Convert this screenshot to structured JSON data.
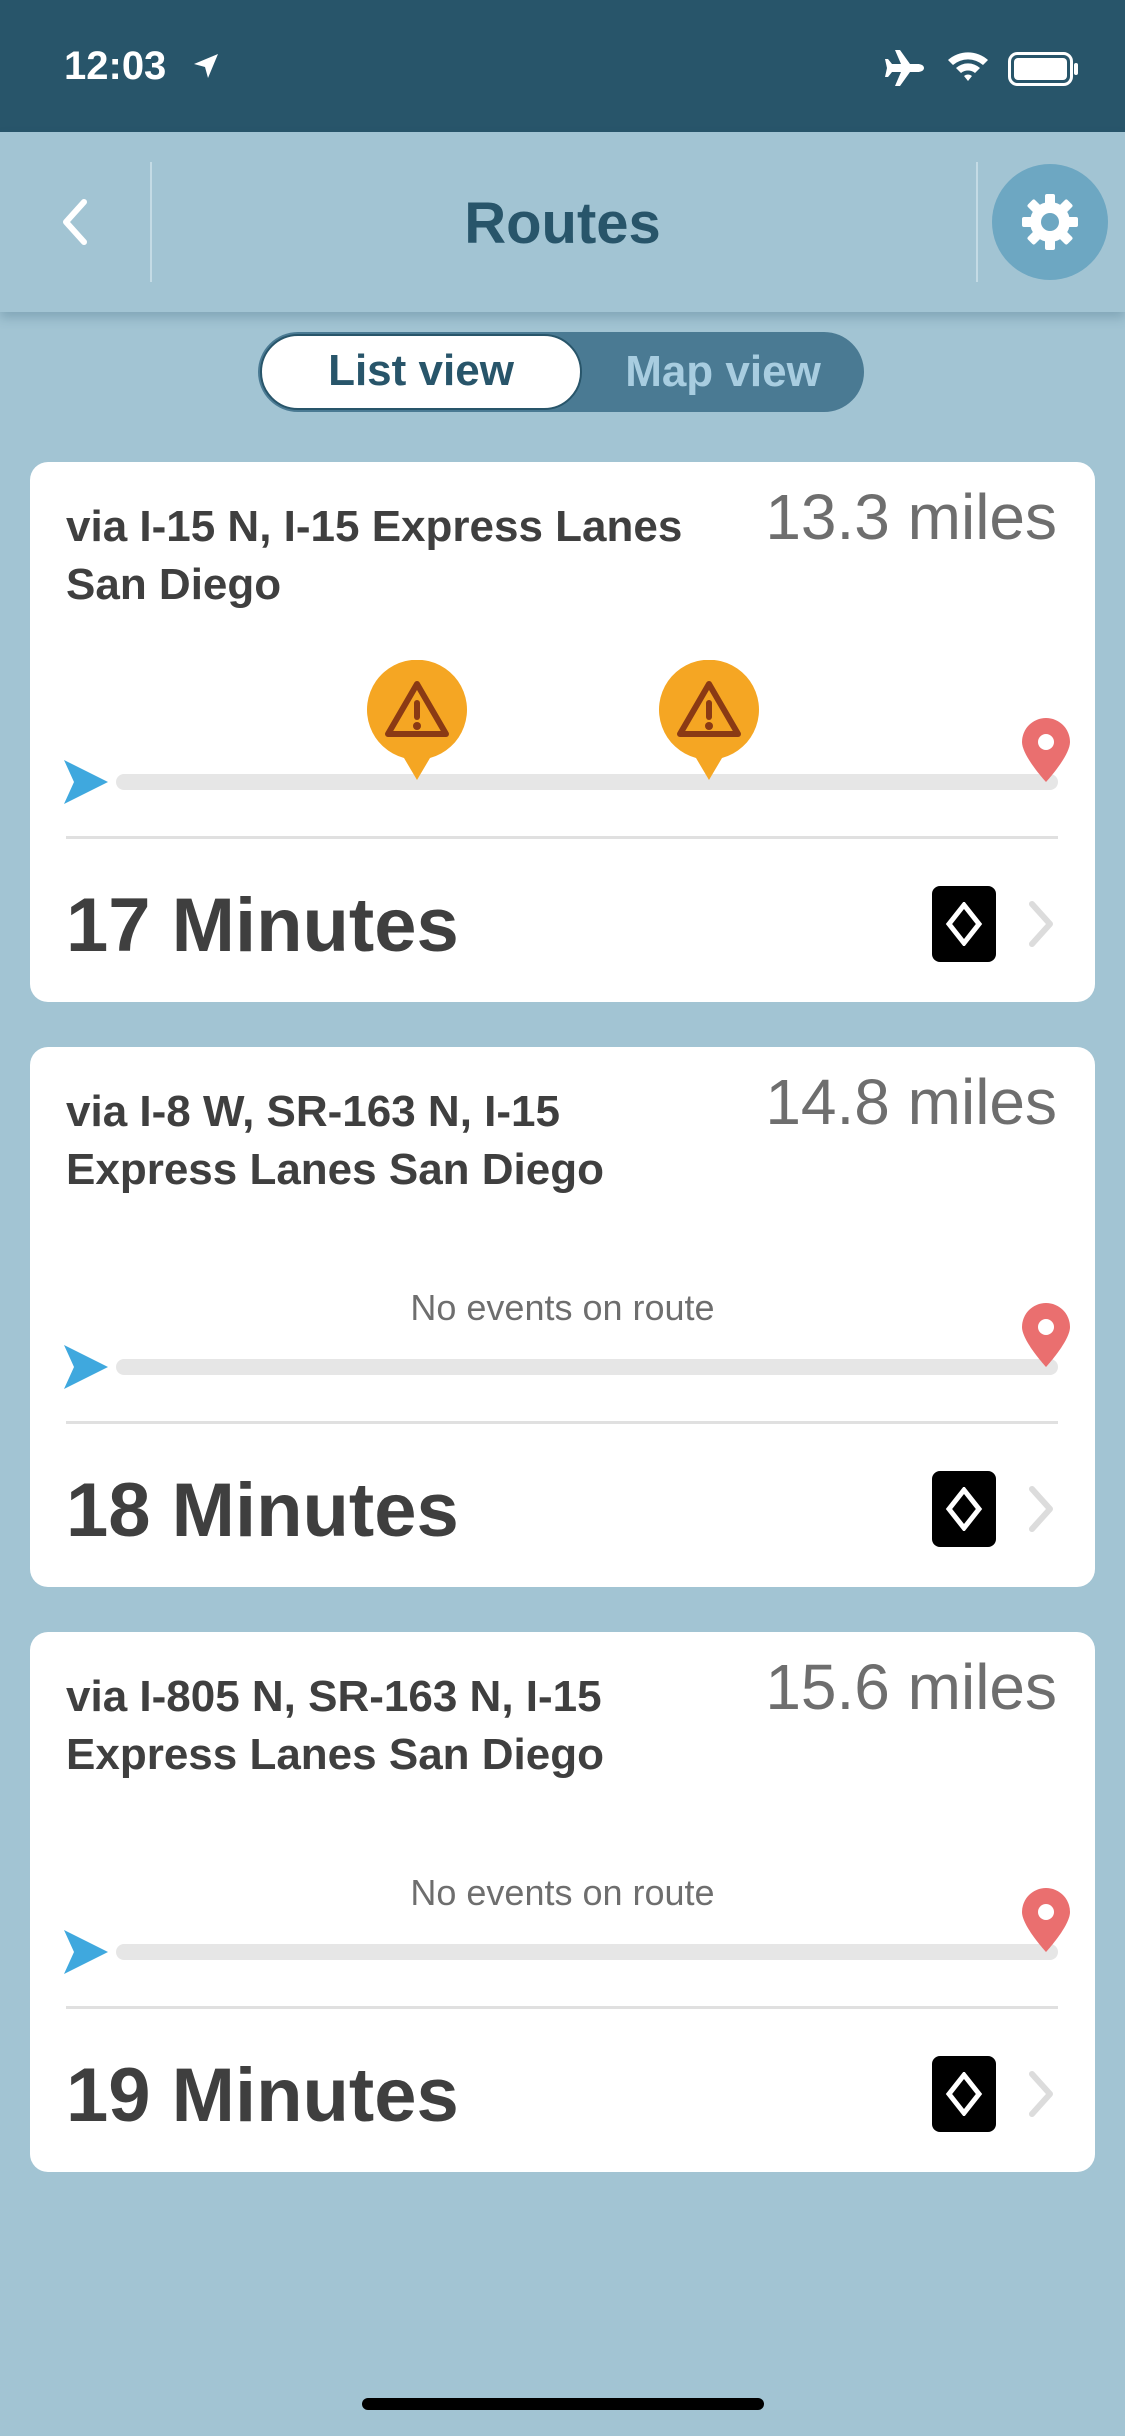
{
  "status_bar": {
    "time": "12:03",
    "icons": [
      "location-arrow-icon",
      "airplane-icon",
      "wifi-icon",
      "battery-icon"
    ]
  },
  "nav": {
    "title": "Routes",
    "back_icon": "chevron-left-icon",
    "settings_icon": "gear-icon"
  },
  "view_toggle": {
    "options": [
      "List view",
      "Map view"
    ],
    "selected": "List view"
  },
  "routes": [
    {
      "via": "via I-15 N, I-15 Express Lanes San Diego",
      "distance": "13.3 miles",
      "events_text": "",
      "warning_positions": [
        0.32,
        0.63
      ],
      "duration": "17 Minutes"
    },
    {
      "via": "via I-8 W, SR-163 N, I-15 Express Lanes San Diego",
      "distance": "14.8 miles",
      "events_text": "No events on route",
      "warning_positions": [],
      "duration": "18 Minutes"
    },
    {
      "via": "via I-805 N, SR-163 N, I-15 Express Lanes San Diego",
      "distance": "15.6 miles",
      "events_text": "No events on route",
      "warning_positions": [],
      "duration": "19 Minutes"
    }
  ],
  "colors": {
    "header": "#28556a",
    "background": "#a2c4d3",
    "start_marker": "#3fa8de",
    "end_marker": "#ea6f6f",
    "warning": "#f5a623"
  }
}
